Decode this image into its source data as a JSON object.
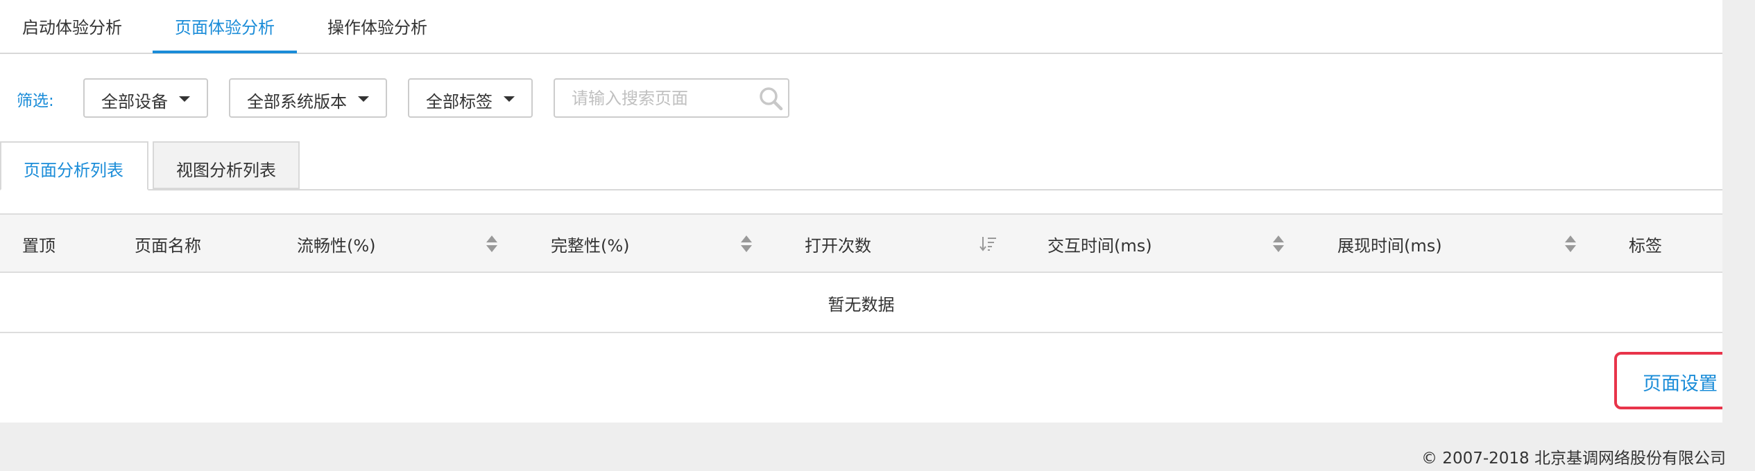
{
  "top_tabs": [
    {
      "label": "启动体验分析",
      "active": false
    },
    {
      "label": "页面体验分析",
      "active": true
    },
    {
      "label": "操作体验分析",
      "active": false
    }
  ],
  "filter": {
    "label": "筛选:",
    "device": "全部设备",
    "system_version": "全部系统版本",
    "tags": "全部标签",
    "search_placeholder": "请输入搜索页面",
    "search_value": ""
  },
  "sub_tabs": [
    {
      "label": "页面分析列表",
      "active": true
    },
    {
      "label": "视图分析列表",
      "active": false
    }
  ],
  "table": {
    "columns": [
      {
        "label": "置顶",
        "sort": "none"
      },
      {
        "label": "页面名称",
        "sort": "none"
      },
      {
        "label": "流畅性(%)",
        "sort": "both"
      },
      {
        "label": "完整性(%)",
        "sort": "both"
      },
      {
        "label": "打开次数",
        "sort": "desc"
      },
      {
        "label": "交互时间(ms)",
        "sort": "both"
      },
      {
        "label": "展现时间(ms)",
        "sort": "both"
      },
      {
        "label": "标签",
        "sort": "none"
      }
    ],
    "empty_text": "暂无数据"
  },
  "settings_button": "页面设置",
  "footer": {
    "copyright": "© 2007-2018  北京基调网络股份有限公司"
  },
  "colors": {
    "accent": "#1a8cd8",
    "highlight_border": "#e8344a"
  },
  "icons": {
    "search": "search-icon",
    "dropdown": "caret-down-icon",
    "sort": "sort-icon",
    "sort_desc": "sort-descending-icon"
  }
}
